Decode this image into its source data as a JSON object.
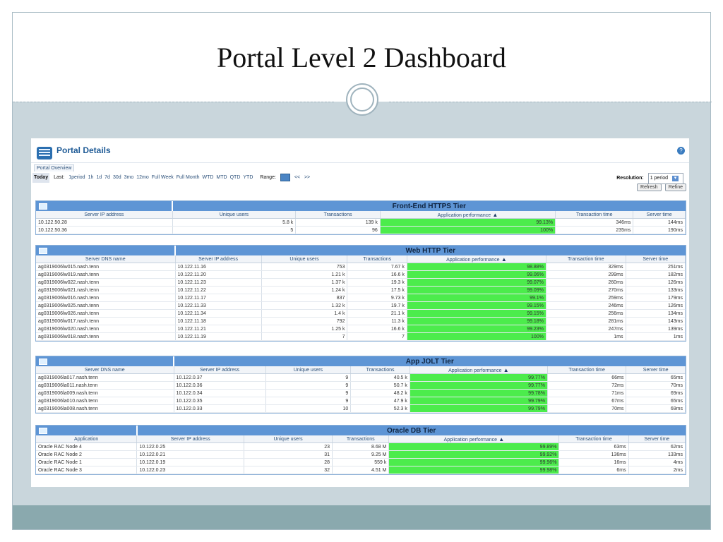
{
  "slide": {
    "title": "Portal Level 2 Dashboard"
  },
  "portal": {
    "title": "Portal Details",
    "tab": "Portal Overview",
    "time_links": [
      "1period",
      "1h",
      "1d",
      "7d",
      "30d",
      "3mo",
      "12mo",
      "Full Week",
      "Full Month",
      "WTD",
      "MTD",
      "QTD",
      "YTD"
    ],
    "today": "Today",
    "last_label": "Last:",
    "range_label": "Range:",
    "prev": "<<",
    "next": ">>",
    "resolution_label": "Resolution:",
    "resolution_value": "1 period",
    "refresh": "Refresh",
    "refine": "Refine"
  },
  "tiers": [
    {
      "name": "Front-End HTTPS Tier",
      "columns": [
        "Server IP address",
        "Unique users",
        "Transactions",
        "Application performance",
        "Transaction time",
        "Server time"
      ],
      "rows": [
        [
          "10.122.50.28",
          "5.8 k",
          "139 k",
          "99.13%",
          "346ms",
          "144ms"
        ],
        [
          "10.122.50.36",
          "5",
          "96",
          "100%",
          "235ms",
          "190ms"
        ]
      ]
    },
    {
      "name": "Web HTTP Tier",
      "columns": [
        "Server DNS name",
        "Server IP address",
        "Unique users",
        "Transactions",
        "Application performance",
        "Transaction time",
        "Server time"
      ],
      "rows": [
        [
          "ag0319006lw015.nash.tenn",
          "10.122.11.16",
          "753",
          "7.67 k",
          "98.88%",
          "329ms",
          "251ms"
        ],
        [
          "ag0319006lw019.nash.tenn",
          "10.122.11.20",
          "1.21 k",
          "16.6 k",
          "99.06%",
          "299ms",
          "182ms"
        ],
        [
          "ag0319006lw022.nash.tenn",
          "10.122.11.23",
          "1.37 k",
          "19.3 k",
          "99.07%",
          "260ms",
          "126ms"
        ],
        [
          "ag0319006lw021.nash.tenn",
          "10.122.11.22",
          "1.24 k",
          "17.5 k",
          "99.09%",
          "270ms",
          "133ms"
        ],
        [
          "ag0319006lw016.nash.tenn",
          "10.122.11.17",
          "837",
          "9.73 k",
          "99.1%",
          "259ms",
          "179ms"
        ],
        [
          "ag0319006lw025.nash.tenn",
          "10.122.11.33",
          "1.32 k",
          "19.7 k",
          "99.15%",
          "246ms",
          "126ms"
        ],
        [
          "ag0319006lw026.nash.tenn",
          "10.122.11.34",
          "1.4 k",
          "21.1 k",
          "99.15%",
          "256ms",
          "134ms"
        ],
        [
          "ag0319006lw017.nash.tenn",
          "10.122.11.18",
          "792",
          "11.3 k",
          "99.18%",
          "281ms",
          "143ms"
        ],
        [
          "ag0319006lw020.nash.tenn",
          "10.122.11.21",
          "1.25 k",
          "16.6 k",
          "99.23%",
          "247ms",
          "139ms"
        ],
        [
          "ag0319006lw018.nash.tenn",
          "10.122.11.19",
          "7",
          "7",
          "100%",
          "1ms",
          "1ms"
        ]
      ]
    },
    {
      "name": "App JOLT Tier",
      "columns": [
        "Server DNS name",
        "Server IP address",
        "Unique users",
        "Transactions",
        "Application performance",
        "Transaction time",
        "Server time"
      ],
      "rows": [
        [
          "ag0319006la017.nash.tenn",
          "10.122.0.37",
          "9",
          "40.5 k",
          "99.77%",
          "66ms",
          "65ms"
        ],
        [
          "ag0319006la011.nash.tenn",
          "10.122.0.36",
          "9",
          "50.7 k",
          "99.77%",
          "72ms",
          "70ms"
        ],
        [
          "ag0319006la009.nash.tenn",
          "10.122.0.34",
          "9",
          "48.2 k",
          "99.78%",
          "71ms",
          "69ms"
        ],
        [
          "ag0319006la010.nash.tenn",
          "10.122.0.35",
          "9",
          "47.9 k",
          "99.79%",
          "67ms",
          "65ms"
        ],
        [
          "ag0319006la008.nash.tenn",
          "10.122.0.33",
          "10",
          "52.3 k",
          "99.79%",
          "70ms",
          "69ms"
        ]
      ]
    },
    {
      "name": "Oracle DB Tier",
      "columns": [
        "Application",
        "Server IP address",
        "Unique users",
        "Transactions",
        "Application performance",
        "Transaction time",
        "Server time"
      ],
      "rows": [
        [
          "Oracle RAC Node 4",
          "10.122.0.25",
          "23",
          "8.68 M",
          "99.89%",
          "63ms",
          "62ms"
        ],
        [
          "Oracle RAC Node 2",
          "10.122.0.21",
          "31",
          "9.25 M",
          "99.92%",
          "136ms",
          "133ms"
        ],
        [
          "Oracle RAC Node 1",
          "10.122.0.19",
          "28",
          "559 k",
          "99.96%",
          "16ms",
          "4ms"
        ],
        [
          "Oracle RAC Node 3",
          "10.122.0.23",
          "32",
          "4.51 M",
          "99.98%",
          "6ms",
          "2ms"
        ]
      ]
    }
  ],
  "colors": {
    "tier_header": "#5e95d5",
    "perf_fill": "#4cec4c",
    "slide_band": "#8aa9ae"
  }
}
